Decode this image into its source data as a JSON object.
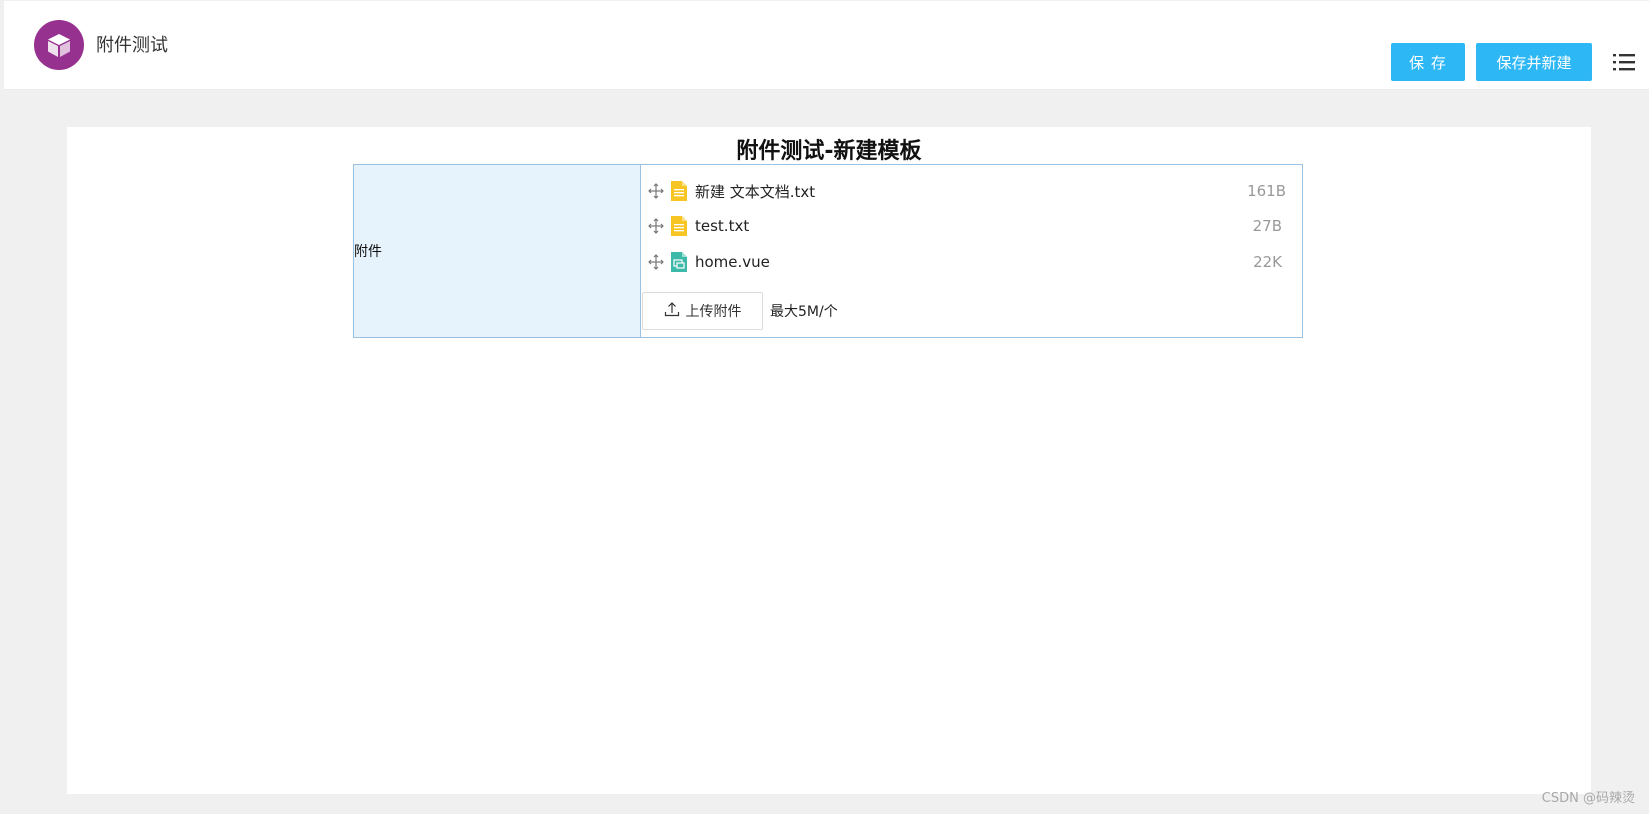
{
  "header": {
    "app_title": "附件测试",
    "logo_icon": "cube-icon",
    "save_label": "保 存",
    "save_new_label": "保存并新建",
    "menu_icon": "list-menu-icon",
    "accent_color": "#2db7f5",
    "logo_color": "#96318f"
  },
  "form": {
    "title": "附件测试-新建模板",
    "field_label": "附件",
    "files": [
      {
        "name": "新建 文本文档.txt",
        "size": "161B",
        "icon": "txt-file-icon"
      },
      {
        "name": "test.txt",
        "size": "27B",
        "icon": "txt-file-icon"
      },
      {
        "name": "home.vue",
        "size": "22K",
        "icon": "vue-file-icon"
      }
    ],
    "upload_label": "上传附件",
    "upload_hint": "最大5M/个"
  },
  "watermark": "CSDN @码辣烫"
}
